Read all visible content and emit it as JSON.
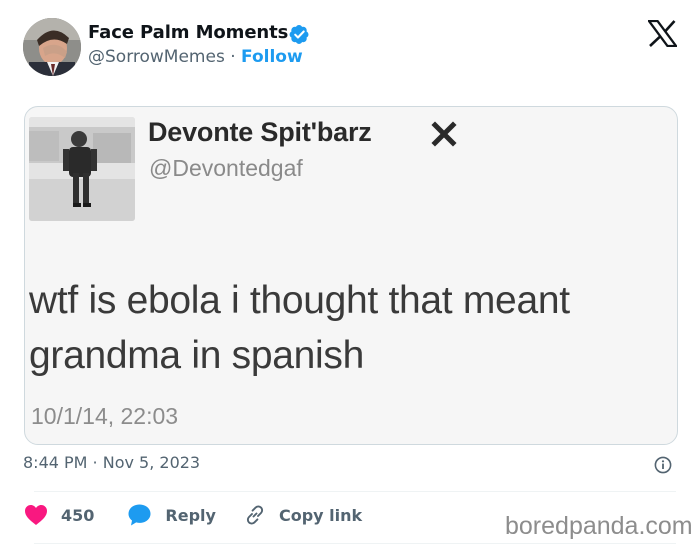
{
  "tweet": {
    "author_name": "Face Palm Moments",
    "handle": "@SorrowMemes",
    "separator": "·",
    "follow_label": "Follow",
    "timestamp": "8:44 PM · Nov 5, 2023"
  },
  "embedded_post": {
    "author_name": "Devonte Spit'barz",
    "handle": "@Devontedgaf",
    "text_line_1": "wtf is ebola i thought that meant",
    "text_line_2": "grandma in spanish",
    "timestamp": "10/1/14, 22:03"
  },
  "actions": {
    "like_count": "450",
    "reply_label": "Reply",
    "copy_link_label": "Copy link"
  },
  "watermark": "boredpanda.com",
  "colors": {
    "accent": "#1d9bf0",
    "like": "#f91880",
    "text_primary": "#0f1419",
    "text_secondary": "#536471",
    "border": "#cfd9de"
  },
  "icons": {
    "brand": "x-logo-icon",
    "verified": "verified-badge-icon",
    "like": "heart-icon",
    "reply": "reply-bubble-icon",
    "copy_link": "link-icon",
    "info": "info-icon"
  }
}
